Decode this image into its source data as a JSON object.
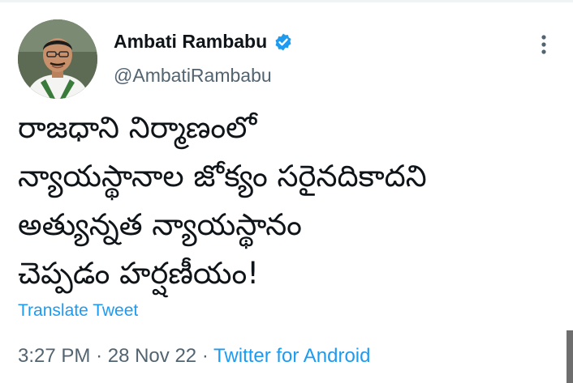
{
  "author": {
    "name": "Ambati Rambabu",
    "handle": "@AmbatiRambabu",
    "avatar_icon": "profile-photo",
    "verified_icon": "verified-badge-icon"
  },
  "tweet": {
    "lines": [
      "రాజధాని నిర్మాణంలో",
      "న్యాయస్థానాల జోక్యం సరైనదికాదని",
      "అత్యున్నత న్యాయస్థానం",
      "చెప్పడం హర్షణీయం!"
    ],
    "translate_label": "Translate Tweet"
  },
  "meta": {
    "time": "3:27 PM",
    "separator": "·",
    "date": "28 Nov 22",
    "source": "Twitter for Android"
  },
  "colors": {
    "text": "#0f1419",
    "secondary": "#536471",
    "accent": "#1d9bf0"
  }
}
